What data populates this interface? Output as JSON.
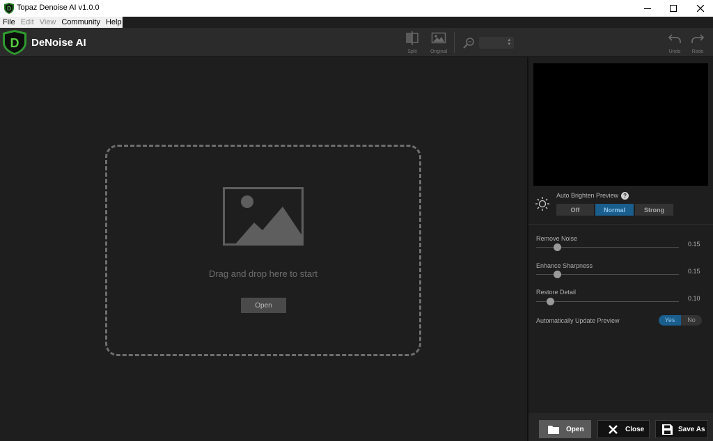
{
  "window": {
    "title": "Topaz Denoise AI v1.0.0"
  },
  "menu": {
    "items": [
      {
        "label": "File",
        "enabled": true
      },
      {
        "label": "Edit",
        "enabled": false
      },
      {
        "label": "View",
        "enabled": false
      },
      {
        "label": "Community",
        "enabled": true
      },
      {
        "label": "Help",
        "enabled": true
      }
    ]
  },
  "toolbar": {
    "app_name": "DeNoise AI",
    "split_label": "Split",
    "original_label": "Original",
    "zoom_value": "",
    "undo_label": "Undo",
    "redo_label": "Redo"
  },
  "canvas": {
    "drop_text": "Drag and drop here to start",
    "open_label": "Open"
  },
  "panel": {
    "auto_brighten": {
      "label": "Auto Brighten Preview",
      "help": "?",
      "options": [
        "Off",
        "Normal",
        "Strong"
      ],
      "selected": "Normal"
    },
    "sliders": [
      {
        "label": "Remove Noise",
        "value": "0.15",
        "fraction": 0.15
      },
      {
        "label": "Enhance Sharpness",
        "value": "0.15",
        "fraction": 0.15
      },
      {
        "label": "Restore Detail",
        "value": "0.10",
        "fraction": 0.1
      }
    ],
    "auto_update": {
      "label": "Automatically Update Preview",
      "yes": "Yes",
      "no": "No",
      "selected": "Yes"
    }
  },
  "bottom": {
    "open_label": "Open",
    "close_label": "Close",
    "save_label": "Save As"
  },
  "colors": {
    "accent": "#1a5e8e",
    "logo_green": "#2e9a2e",
    "background": "#1e1e1e"
  }
}
